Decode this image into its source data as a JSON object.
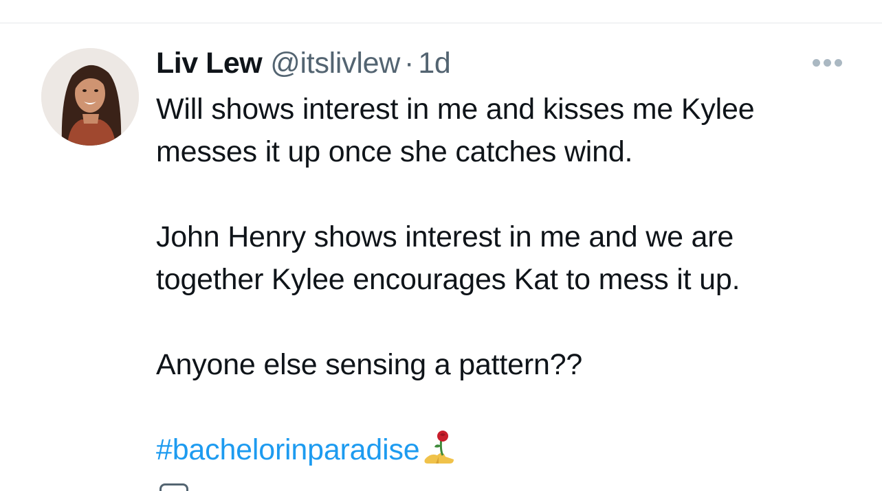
{
  "tweet": {
    "author_name": "Liv Lew",
    "author_handle": "@itslivlew",
    "separator": "·",
    "timestamp": "1d",
    "lines": [
      "Will shows interest in me and kisses me Kylee",
      "messes it up once she catches wind.",
      "",
      "John Henry shows interest in me and we are",
      "together Kylee encourages Kat to mess it up.",
      "",
      "Anyone else sensing a pattern??",
      ""
    ],
    "hashtag": "#bachelorinparadise",
    "emoji": "rose-and-high-heel-emoji"
  },
  "icons": {
    "more": "more-options-icon",
    "avatar": "profile-photo"
  },
  "colors": {
    "text": "#0f1419",
    "secondary": "#536471",
    "link": "#1d9bf0"
  }
}
